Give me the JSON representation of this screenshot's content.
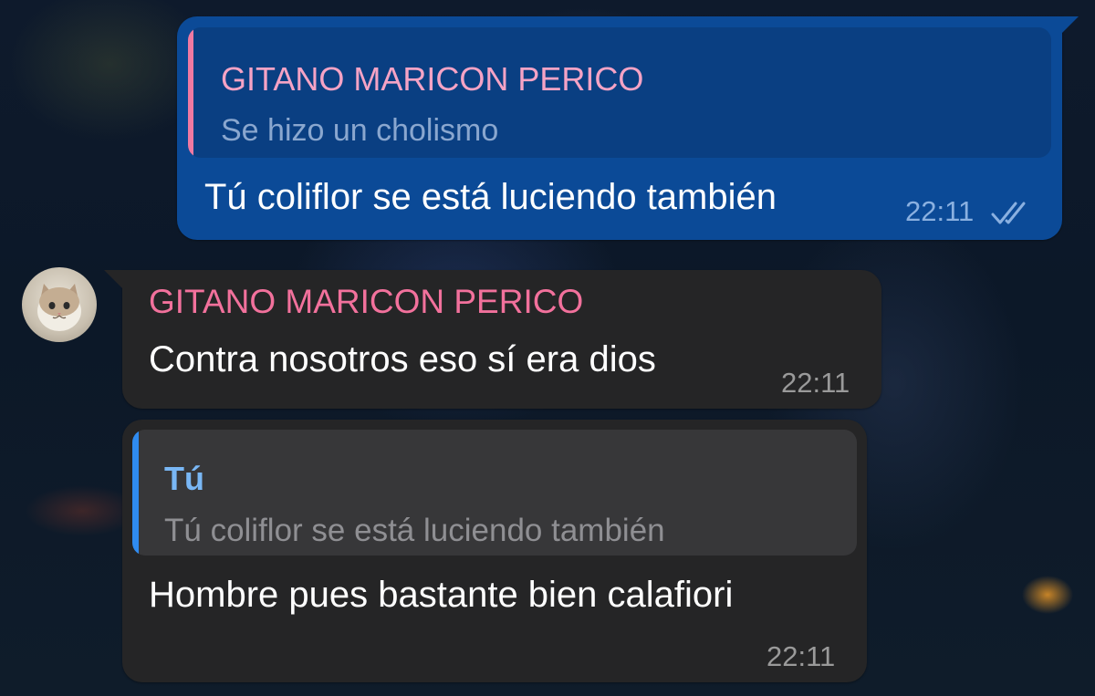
{
  "messages": [
    {
      "direction": "outgoing",
      "reply_to": {
        "author": "GITANO MARICON PERICO",
        "text": "Se hizo un cholismo"
      },
      "text": "Tú coliflor se está luciendo también",
      "time": "22:11",
      "status_icon": "double-check-icon"
    },
    {
      "direction": "incoming",
      "author": "GITANO MARICON PERICO",
      "text": "Contra nosotros eso sí era dios",
      "time": "22:11"
    },
    {
      "direction": "incoming",
      "reply_to": {
        "author": "Tú",
        "text": "Tú coliflor se está luciendo también"
      },
      "text": "Hombre pues bastante bien calafiori",
      "time": "22:11"
    }
  ],
  "colors": {
    "outgoing_bubble": "#0b4a97",
    "incoming_bubble": "#252526",
    "sender_name": "#f2719c",
    "reply_bar_pink": "#ef79a2",
    "reply_bar_blue": "#2f8bf0",
    "reply_author_blue": "#79b7f5"
  }
}
